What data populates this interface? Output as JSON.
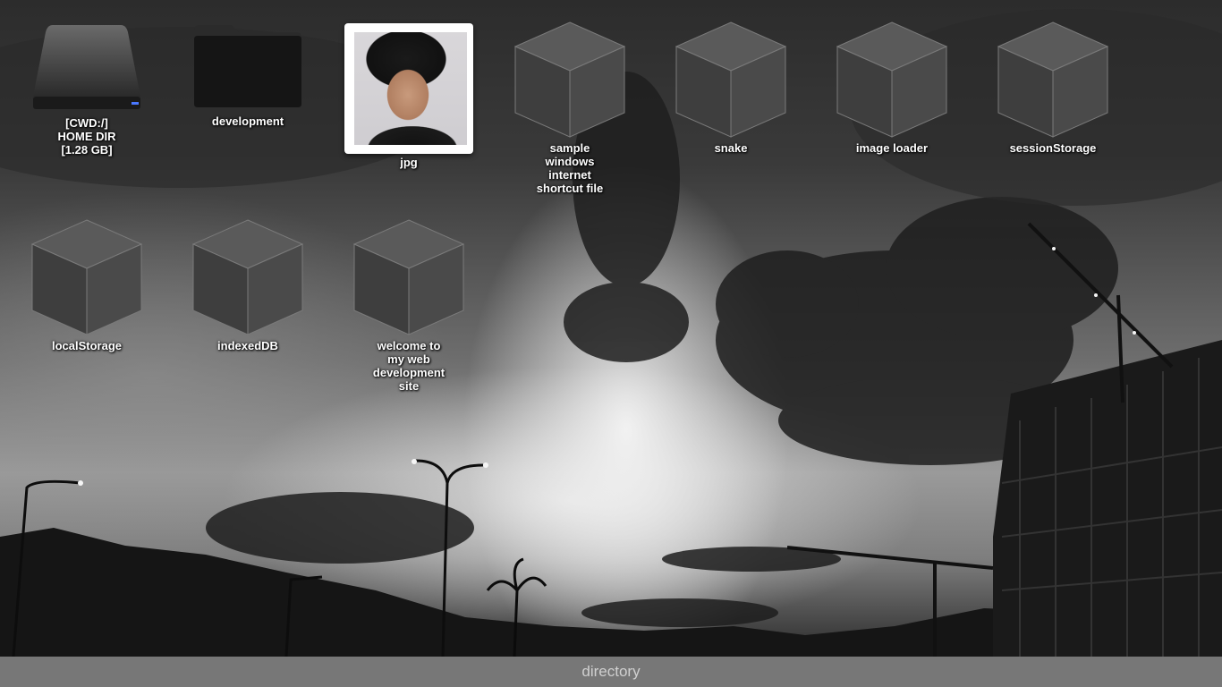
{
  "desktop": {
    "icons": [
      {
        "kind": "drive",
        "label": "[CWD:/]\nHOME DIR\n[1.28 GB]",
        "icon": "hard-drive-icon"
      },
      {
        "kind": "folder",
        "label": "development",
        "icon": "folder-icon"
      },
      {
        "kind": "photo",
        "label": "jpg",
        "icon": "image-thumbnail"
      },
      {
        "kind": "cube",
        "label": "sample windows internet shortcut file",
        "icon": "cube-icon"
      },
      {
        "kind": "cube",
        "label": "snake",
        "icon": "cube-icon"
      },
      {
        "kind": "cube",
        "label": "image loader",
        "icon": "cube-icon"
      },
      {
        "kind": "cube",
        "label": "sessionStorage",
        "icon": "cube-icon"
      },
      {
        "kind": "cube",
        "label": "localStorage",
        "icon": "cube-icon"
      },
      {
        "kind": "cube",
        "label": "indexedDB",
        "icon": "cube-icon"
      },
      {
        "kind": "cube",
        "label": "welcome to my web development site",
        "icon": "cube-icon"
      }
    ]
  },
  "taskbar": {
    "label": "directory"
  },
  "colors": {
    "taskbar_bg": "#777777",
    "taskbar_text": "#d0d0d0",
    "icon_label": "#ffffff"
  }
}
